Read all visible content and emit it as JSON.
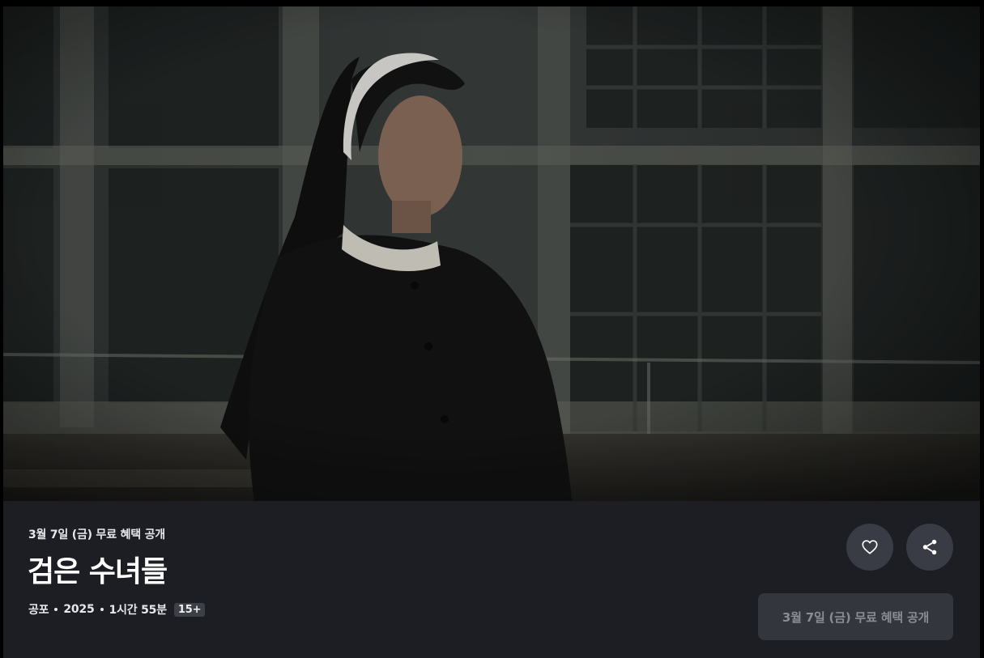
{
  "hero": {
    "image_subject": "nun-in-black-habit-still"
  },
  "info": {
    "promo_label": "3월 7일 (금) 무료 혜택 공개",
    "title": "검은 수녀들",
    "genre": "공포",
    "year": "2025",
    "runtime": "1시간 55분",
    "age_rating": "15+"
  },
  "actions": {
    "like_icon": "heart-icon",
    "share_icon": "share-icon",
    "cta_label": "3월 7일 (금) 무료 혜택 공개"
  },
  "colors": {
    "panel_bg": "#1c1e23",
    "button_bg": "#393c44",
    "cta_bg": "#33363d",
    "cta_text": "#8a8d94"
  }
}
